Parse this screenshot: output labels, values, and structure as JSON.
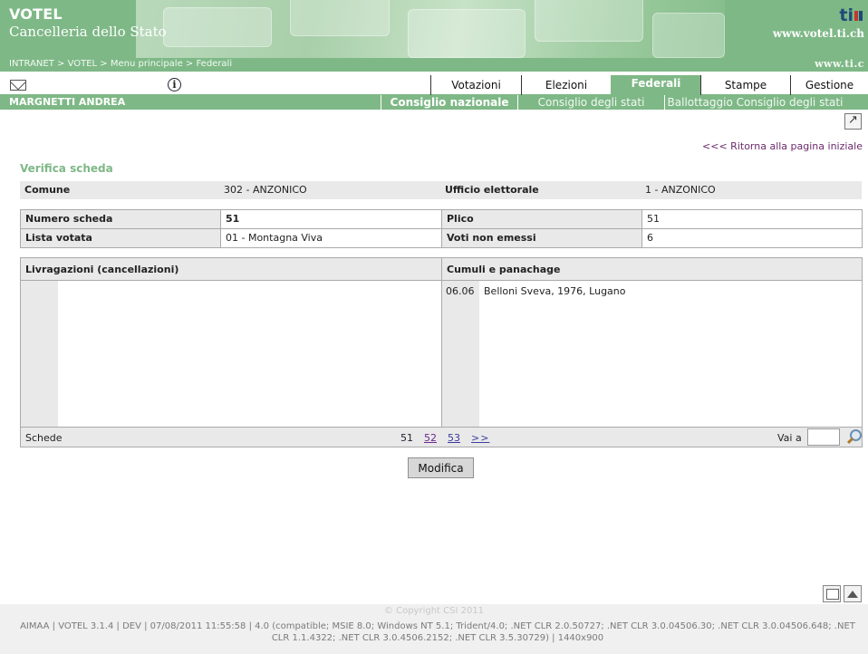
{
  "header": {
    "brand_line1": "VOTEL",
    "brand_line2": "Cancelleria dello Stato",
    "logo_text": "ti",
    "url_text": "www.votel.ti.ch",
    "breadcrumb": "INTRANET > VOTEL > Menu principale > Federali",
    "site_text": "www.ti.c"
  },
  "nav": {
    "tabs": [
      {
        "label": "Votazioni"
      },
      {
        "label": "Elezioni"
      },
      {
        "label": "Federali"
      },
      {
        "label": "Stampe"
      },
      {
        "label": "Gestione"
      }
    ],
    "active_tab": "Federali"
  },
  "user": {
    "name": "MARGNETTI ANDREA"
  },
  "subnav": {
    "tabs": [
      {
        "label": "Consiglio nazionale"
      },
      {
        "label": "Consiglio degli stati"
      },
      {
        "label": "Ballottaggio Consiglio degli stati"
      }
    ],
    "active_tab": "Consiglio nazionale"
  },
  "back_link": "<<< Ritorna alla pagina iniziale",
  "section_title": "Verifica scheda",
  "info1": {
    "comune_label": "Comune",
    "comune_value": "302 - ANZONICO",
    "ufficio_label": "Ufficio elettorale",
    "ufficio_value": "1 - ANZONICO"
  },
  "info2": {
    "numero_label": "Numero scheda",
    "numero_value": "51",
    "plico_label": "Plico",
    "plico_value": "51",
    "lista_label": "Lista votata",
    "lista_value": "01 - Montagna Viva",
    "voti_label": "Voti non emessi",
    "voti_value": "6"
  },
  "panel": {
    "left_header": "Livragazioni (cancellazioni)",
    "right_header": "Cumuli e panachage",
    "entries": [
      {
        "code": "06.06",
        "name": "Belloni Sveva, 1976, Lugano"
      }
    ],
    "footer_label": "Schede",
    "pages": [
      "51",
      "52",
      "53"
    ],
    "next_label": ">>",
    "goto_label": "Vai a",
    "goto_value": ""
  },
  "buttons": {
    "modifica": "Modifica"
  },
  "footer": {
    "copyright": "© Copyright CSI 2011",
    "system_info": "AIMAA | VOTEL 3.1.4 | DEV | 07/08/2011 11:55:58 | 4.0 (compatible; MSIE 8.0; Windows NT 5.1; Trident/4.0; .NET CLR 2.0.50727; .NET CLR 3.0.04506.30; .NET CLR 3.0.04506.648; .NET CLR 1.1.4322; .NET CLR 3.0.4506.2152; .NET CLR 3.5.30729) | 1440x900"
  },
  "colors": {
    "accent_green": "#7eb886",
    "panel_gray": "#e9e9e9",
    "link_purple": "#6b2a6b"
  },
  "icons": [
    "mail-icon",
    "info-icon",
    "external-link-icon",
    "search-icon",
    "print-icon",
    "scroll-top-icon"
  ]
}
